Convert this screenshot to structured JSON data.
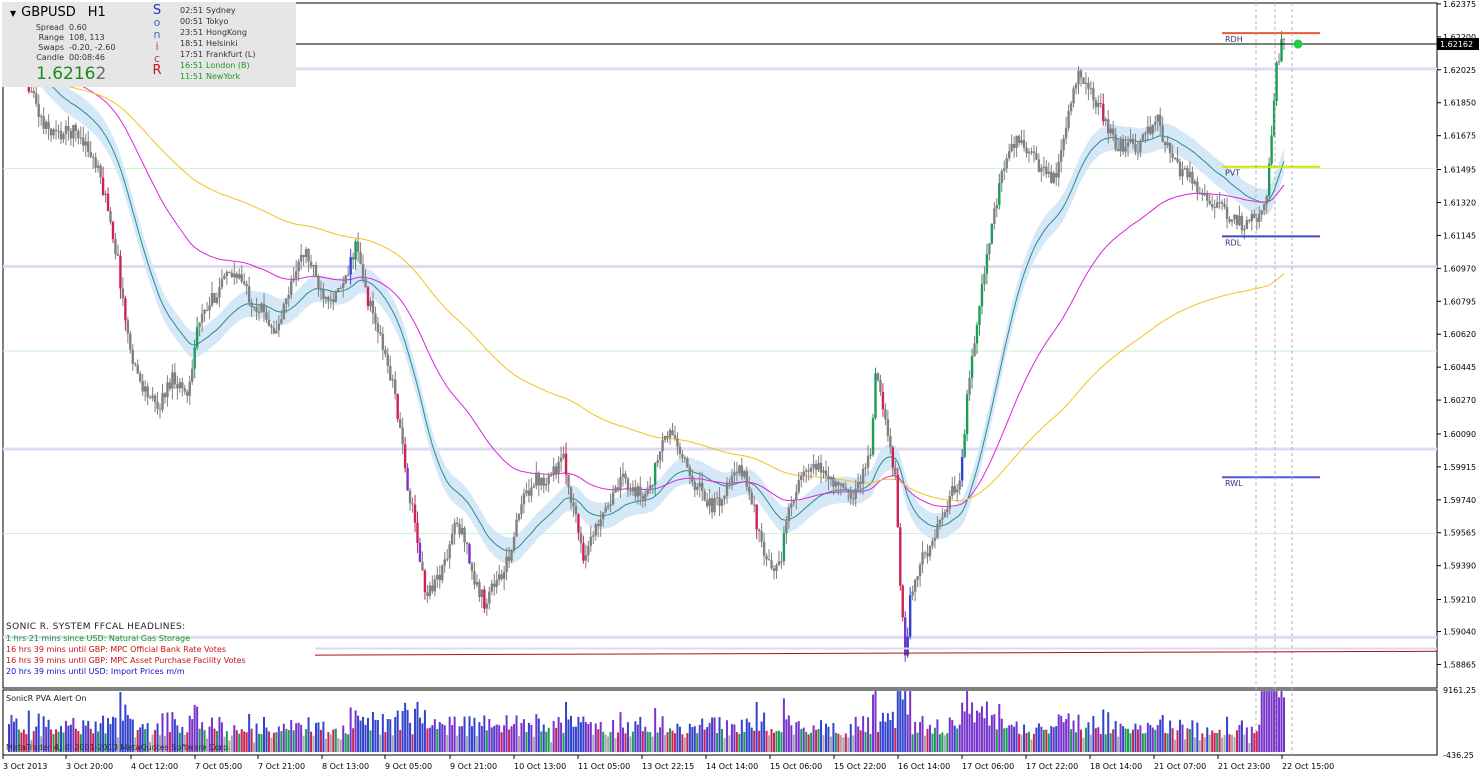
{
  "symbol": "GBPUSD",
  "timeframe": "H1",
  "stats": [
    {
      "label": "Spread",
      "value": "0.60"
    },
    {
      "label": "Range",
      "value": "108, 113"
    },
    {
      "label": "Swaps",
      "value": "-0.20, -2.60"
    },
    {
      "label": "Candle",
      "value": "00:08:46"
    }
  ],
  "price_main": "1.6216",
  "price_last_digit": "2",
  "sonic_letters": [
    "S",
    "o",
    "n",
    "i",
    "c",
    "R"
  ],
  "sessions": [
    {
      "time": "02:51",
      "name": "Sydney"
    },
    {
      "time": "00:51",
      "name": "Tokyo"
    },
    {
      "time": "23:51",
      "name": "HongKong"
    },
    {
      "time": "18:51",
      "name": "Helsinki"
    },
    {
      "time": "17:51",
      "name": "Frankfurt  (L)"
    },
    {
      "time": "16:51",
      "name": "London  (B)"
    },
    {
      "time": "11:51",
      "name": "NewYork"
    }
  ],
  "news_title": "SONIC R. SYSTEM  FFCAL HEADLINES:",
  "news": [
    {
      "text": "1 hrs 21 mins since USD: Natural Gas Storage",
      "color": "#1a9a1a"
    },
    {
      "text": "16 hrs 39 mins until GBP: MPC Official Bank Rate Votes",
      "color": "#cc1111"
    },
    {
      "text": "16 hrs 39 mins until GBP: MPC Asset Purchase Facility Votes",
      "color": "#cc1111"
    },
    {
      "text": "20 hrs 39 mins until USD: Import Prices m/m",
      "color": "#1111cc"
    }
  ],
  "sub_window_label": "SonicR PVA    Alert On",
  "footer_text": "MetaTrader 4, © 2001-2013 MetaQuotes Software Corp.",
  "colors": {
    "bull_candle": "#1e9a5a",
    "bear_candle": "#cc2255",
    "neutral_candle": "#808080",
    "bull_high_volume": "#7733cc",
    "bear_high_volume": "#3344cc",
    "dragon_band": "#cfe6f7",
    "dragon_mid": "#2a8a8a",
    "ema89": "#dd22dd",
    "ema200": "#f2c21a",
    "rdh": "#e85a3a",
    "pvt": "#dddd00",
    "rdl": "#4444cc",
    "rwl": "#5555dd",
    "price_line": "#000000",
    "support_line": "#c9f2c9",
    "resistance_line": "#dcdcf2"
  },
  "chart_data": [
    {
      "type": "candlestick",
      "title": "GBPUSD H1",
      "ylim": [
        1.5874,
        1.6238
      ],
      "y_ticks": [
        "1.62375",
        "1.62200",
        "1.62025",
        "1.61850",
        "1.61675",
        "1.61495",
        "1.61320",
        "1.61145",
        "1.60970",
        "1.60795",
        "1.60620",
        "1.60445",
        "1.60270",
        "1.60090",
        "1.59915",
        "1.59740",
        "1.59565",
        "1.59390",
        "1.59210",
        "1.59040",
        "1.58865"
      ],
      "current_price": "1.62162",
      "x_ticks": [
        "3 Oct 2013",
        "3 Oct 20:00",
        "4 Oct 12:00",
        "7 Oct 05:00",
        "7 Oct 21:00",
        "8 Oct 13:00",
        "9 Oct 05:00",
        "9 Oct 21:00",
        "10 Oct 13:00",
        "11 Oct 05:00",
        "13 Oct 22:15",
        "14 Oct 14:00",
        "15 Oct 06:00",
        "15 Oct 22:00",
        "16 Oct 14:00",
        "17 Oct 06:00",
        "17 Oct 22:00",
        "18 Oct 14:00",
        "21 Oct 07:00",
        "21 Oct 23:00",
        "22 Oct 15:00"
      ],
      "levels": [
        {
          "label": "RDH",
          "value": 1.6222
        },
        {
          "label": "PVT",
          "value": 1.6151
        },
        {
          "label": "RDL",
          "value": 1.6114
        },
        {
          "label": "RWL",
          "value": 1.5986
        }
      ],
      "horizontal_lines": [
        1.6203,
        1.615,
        1.6098,
        1.6053,
        1.6001,
        1.5956,
        1.5901
      ],
      "close_path": [
        [
          0,
          1.6212
        ],
        [
          8,
          1.6195
        ],
        [
          14,
          1.6172
        ],
        [
          20,
          1.6168
        ],
        [
          26,
          1.617
        ],
        [
          30,
          1.6166
        ],
        [
          36,
          1.6148
        ],
        [
          40,
          1.613
        ],
        [
          44,
          1.61
        ],
        [
          48,
          1.606
        ],
        [
          52,
          1.604
        ],
        [
          56,
          1.603
        ],
        [
          60,
          1.6022
        ],
        [
          66,
          1.604
        ],
        [
          72,
          1.603
        ],
        [
          76,
          1.6065
        ],
        [
          80,
          1.6075
        ],
        [
          86,
          1.609
        ],
        [
          92,
          1.6095
        ],
        [
          98,
          1.608
        ],
        [
          104,
          1.6072
        ],
        [
          108,
          1.6062
        ],
        [
          112,
          1.608
        ],
        [
          116,
          1.6098
        ],
        [
          120,
          1.6105
        ],
        [
          126,
          1.6085
        ],
        [
          132,
          1.6082
        ],
        [
          136,
          1.609
        ],
        [
          140,
          1.611
        ],
        [
          144,
          1.6085
        ],
        [
          148,
          1.6068
        ],
        [
          152,
          1.605
        ],
        [
          156,
          1.603
        ],
        [
          160,
          1.599
        ],
        [
          164,
          1.596
        ],
        [
          168,
          1.5925
        ],
        [
          172,
          1.593
        ],
        [
          176,
          1.594
        ],
        [
          180,
          1.596
        ],
        [
          184,
          1.5955
        ],
        [
          188,
          1.593
        ],
        [
          192,
          1.592
        ],
        [
          196,
          1.593
        ],
        [
          200,
          1.5935
        ],
        [
          204,
          1.5955
        ],
        [
          208,
          1.5975
        ],
        [
          212,
          1.5985
        ],
        [
          216,
          1.5985
        ],
        [
          220,
          1.599
        ],
        [
          224,
          1.5995
        ],
        [
          228,
          1.597
        ],
        [
          232,
          1.5945
        ],
        [
          236,
          1.5955
        ],
        [
          240,
          1.597
        ],
        [
          244,
          1.5975
        ],
        [
          248,
          1.5985
        ],
        [
          252,
          1.598
        ],
        [
          256,
          1.5975
        ],
        [
          260,
          1.5985
        ],
        [
          264,
          1.6005
        ],
        [
          268,
          1.601
        ],
        [
          272,
          1.5995
        ],
        [
          276,
          1.5985
        ],
        [
          280,
          1.5978
        ],
        [
          284,
          1.597
        ],
        [
          288,
          1.5975
        ],
        [
          292,
          1.5985
        ],
        [
          296,
          1.599
        ],
        [
          300,
          1.5975
        ],
        [
          304,
          1.5948
        ],
        [
          308,
          1.5935
        ],
        [
          312,
          1.5945
        ],
        [
          316,
          1.5975
        ],
        [
          320,
          1.5985
        ],
        [
          324,
          1.599
        ],
        [
          328,
          1.599
        ],
        [
          332,
          1.5985
        ],
        [
          336,
          1.598
        ],
        [
          340,
          1.5975
        ],
        [
          344,
          1.5985
        ],
        [
          348,
          1.6
        ],
        [
          350,
          1.604
        ],
        [
          352,
          1.603
        ],
        [
          356,
          1.6
        ],
        [
          358,
          1.599
        ],
        [
          360,
          1.593
        ],
        [
          362,
          1.589
        ],
        [
          364,
          1.592
        ],
        [
          368,
          1.594
        ],
        [
          372,
          1.595
        ],
        [
          376,
          1.596
        ],
        [
          380,
          1.5975
        ],
        [
          384,
          1.5985
        ],
        [
          388,
          1.604
        ],
        [
          392,
          1.608
        ],
        [
          396,
          1.611
        ],
        [
          400,
          1.614
        ],
        [
          404,
          1.616
        ],
        [
          408,
          1.6165
        ],
        [
          412,
          1.616
        ],
        [
          416,
          1.615
        ],
        [
          420,
          1.6145
        ],
        [
          424,
          1.615
        ],
        [
          428,
          1.618
        ],
        [
          432,
          1.6205
        ],
        [
          436,
          1.619
        ],
        [
          440,
          1.6185
        ],
        [
          444,
          1.617
        ],
        [
          448,
          1.616
        ],
        [
          452,
          1.6165
        ],
        [
          456,
          1.616
        ],
        [
          460,
          1.617
        ],
        [
          464,
          1.6175
        ],
        [
          468,
          1.616
        ],
        [
          472,
          1.615
        ],
        [
          476,
          1.6148
        ],
        [
          480,
          1.614
        ],
        [
          484,
          1.6135
        ],
        [
          488,
          1.613
        ],
        [
          492,
          1.6125
        ],
        [
          496,
          1.6122
        ],
        [
          500,
          1.612
        ],
        [
          504,
          1.6125
        ],
        [
          508,
          1.6135
        ],
        [
          510,
          1.617
        ],
        [
          512,
          1.6205
        ],
        [
          514,
          1.6216
        ]
      ]
    },
    {
      "type": "bar",
      "title": "SonicR PVA",
      "ylim": [
        -436.25,
        9161.25
      ],
      "y_ticks": [
        "9161.25",
        "-436.25"
      ]
    }
  ]
}
